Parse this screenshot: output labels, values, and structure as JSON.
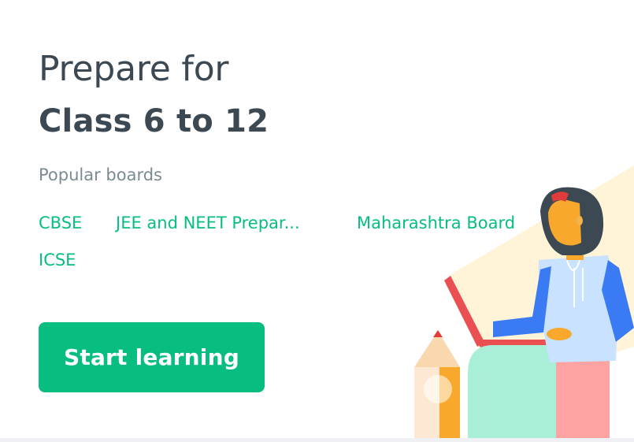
{
  "hero": {
    "pre_title": "Prepare for",
    "title": "Class 6 to 12",
    "boards_label": "Popular boards",
    "boards": [
      "CBSE",
      "JEE and NEET Prepar...",
      "Maharashtra Board",
      "ICSE"
    ],
    "cta_label": "Start learning"
  },
  "colors": {
    "text": "#3c4852",
    "muted": "#7a8b94",
    "accent": "#08bd80"
  }
}
